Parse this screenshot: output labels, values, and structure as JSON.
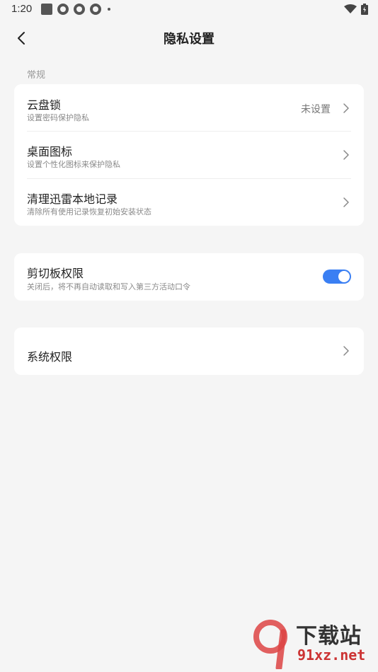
{
  "status_bar": {
    "time": "1:20"
  },
  "header": {
    "title": "隐私设置"
  },
  "section_general": "常规",
  "cloud_lock": {
    "title": "云盘锁",
    "subtitle": "设置密码保护隐私",
    "value": "未设置"
  },
  "desktop_icon": {
    "title": "桌面图标",
    "subtitle": "设置个性化图标来保护隐私"
  },
  "clear_records": {
    "title": "清理迅雷本地记录",
    "subtitle": "清除所有使用记录恢复初始安装状态"
  },
  "clipboard": {
    "title": "剪切板权限",
    "subtitle": "关闭后，将不再自动读取和写入第三方活动口令",
    "enabled": true
  },
  "system_permission": {
    "title": "系统权限"
  },
  "watermark": {
    "brand": "下载站",
    "url": "91xz.net"
  },
  "colors": {
    "accent": "#3a7ff3",
    "background": "#f5f5f5"
  }
}
